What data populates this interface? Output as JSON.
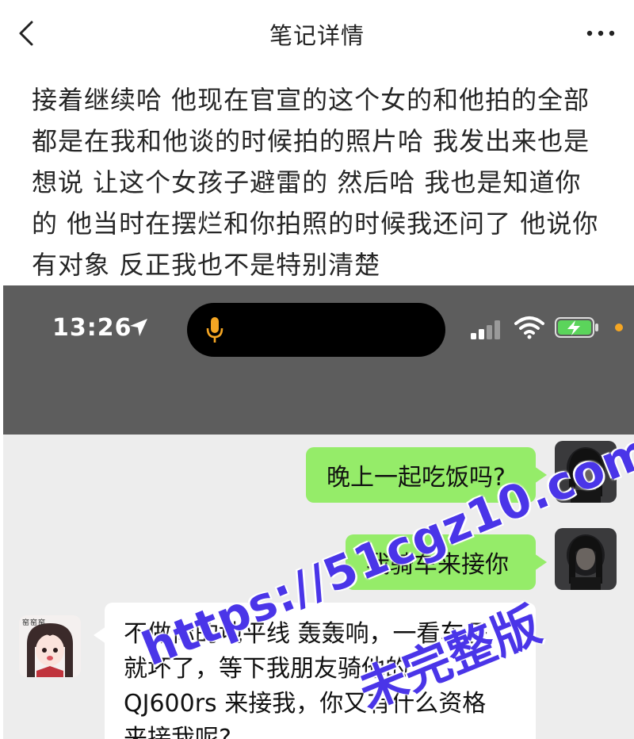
{
  "nav": {
    "title": "笔记详情"
  },
  "note": {
    "lines": [
      "接着继续哈 他现在官宣的这个女的和他拍的全部",
      "都是在我和他谈的时候拍的照片哈 我发出来也是",
      "想说 让这个女孩子避雷的  然后哈 我也是知道你",
      "的 他当时在摆烂和你拍照的时候我还问了 他说你",
      "有对象 反正我也不是特别清楚"
    ]
  },
  "screenshot": {
    "status_bar": {
      "time": "13:26"
    },
    "messages": [
      {
        "side": "right",
        "text": "晚上一起吃饭吗?"
      },
      {
        "side": "right",
        "text": "我骑车来接你"
      },
      {
        "side": "left",
        "lines": [
          "不做你的地平线 轰轰响，一看车子",
          "就坏了，等下我朋友骑他的",
          "QJ600rs 来接我，你又有什么资格",
          "来接我呢?"
        ]
      }
    ],
    "left_avatar_caption": "窑窑窑"
  },
  "watermark": {
    "url": "https://51cgz10.com",
    "label": "未完整版"
  },
  "colors": {
    "outgoing_bubble": "#95ec69",
    "incoming_bubble": "#ffffff",
    "chat_background": "#ededed",
    "status_bar": "#5d5d5d",
    "watermark": "#4a35e8"
  },
  "icons": [
    "back-icon",
    "more-icon",
    "location-arrow-icon",
    "microphone-icon",
    "signal-icon",
    "wifi-icon",
    "battery-charging-icon"
  ]
}
